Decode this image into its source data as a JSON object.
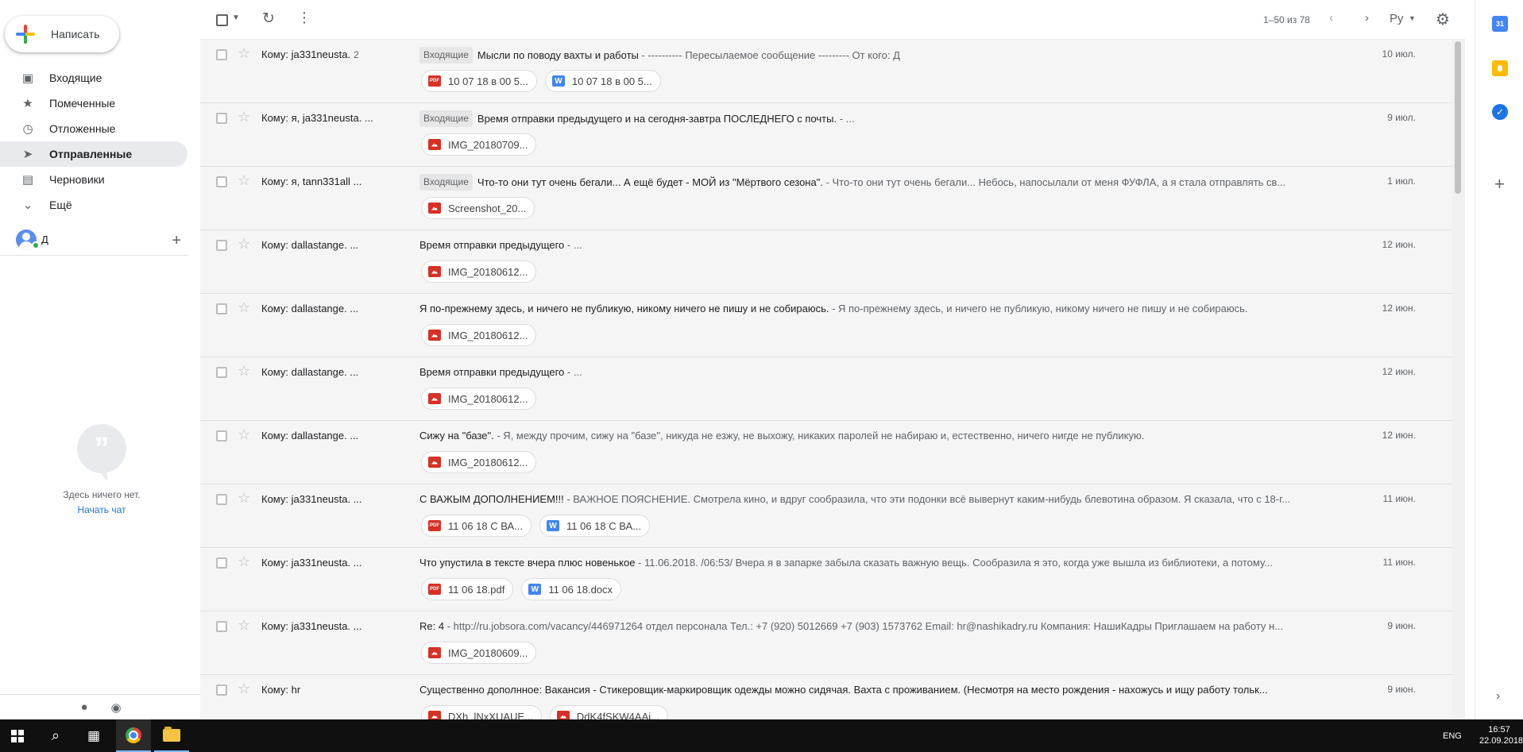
{
  "sidebar": {
    "compose_label": "Написать",
    "nav": [
      {
        "label": "Входящие",
        "icon": "inbox-icon",
        "active": false
      },
      {
        "label": "Помеченные",
        "icon": "star-icon",
        "active": false
      },
      {
        "label": "Отложенные",
        "icon": "clock-icon",
        "active": false
      },
      {
        "label": "Отправленные",
        "icon": "send-icon",
        "active": true
      },
      {
        "label": "Черновики",
        "icon": "draft-icon",
        "active": false
      },
      {
        "label": "Ещё",
        "icon": "chevron-down-icon",
        "active": false
      }
    ],
    "user": {
      "name": "Д"
    },
    "hangouts": {
      "empty_text": "Здесь ничего нет.",
      "start_chat": "Начать чат"
    }
  },
  "toolbar": {
    "pagination": "1–50 из 78",
    "language": "Ру"
  },
  "emails": [
    {
      "sender": "Кому: ja331neusta.",
      "count": "2",
      "badge": "Входящие",
      "subject": "Мысли по поводу вахты и работы",
      "snippet": " - ---------- Пересылаемое сообщение --------- От кого: Д",
      "date": "10 июл.",
      "attachments": [
        {
          "name": "10 07 18 в 00 5...",
          "type": "pdf"
        },
        {
          "name": "10 07 18 в 00 5...",
          "type": "doc"
        }
      ]
    },
    {
      "sender": "Кому: я, ja331neusta. ...",
      "count": "",
      "badge": "Входящие",
      "subject": "Время отправки предыдущего и на сегодня-завтра ПОСЛЕДНЕГО с почты.",
      "snippet": " - ...",
      "date": "9 июл.",
      "attachments": [
        {
          "name": "IMG_20180709...",
          "type": "img"
        }
      ]
    },
    {
      "sender": "Кому: я, tann331all ...",
      "count": "",
      "badge": "Входящие",
      "subject": "Что-то они тут очень бегали... А ещё будет - МОЙ из \"Мёртвого сезона\".",
      "snippet": " - Что-то они тут очень бегали... Небось, напосылали от меня ФУФЛА, а я стала отправлять св...",
      "date": "1 июл.",
      "attachments": [
        {
          "name": "Screenshot_20...",
          "type": "img"
        }
      ]
    },
    {
      "sender": "Кому: dallastange. ...",
      "count": "",
      "badge": "",
      "subject": "Время отправки предыдущего",
      "snippet": " - ...",
      "date": "12 июн.",
      "attachments": [
        {
          "name": "IMG_20180612...",
          "type": "img"
        }
      ]
    },
    {
      "sender": "Кому: dallastange. ...",
      "count": "",
      "badge": "",
      "subject": "Я по-прежнему здесь, и ничего не публикую, никому ничего не пишу и не собираюсь.",
      "snippet": " - Я по-прежнему здесь, и ничего не публикую, никому ничего не пишу и не собираюсь.",
      "date": "12 июн.",
      "attachments": [
        {
          "name": "IMG_20180612...",
          "type": "img"
        }
      ]
    },
    {
      "sender": "Кому: dallastange. ...",
      "count": "",
      "badge": "",
      "subject": "Время отправки предыдущего",
      "snippet": " - ...",
      "date": "12 июн.",
      "attachments": [
        {
          "name": "IMG_20180612...",
          "type": "img"
        }
      ]
    },
    {
      "sender": "Кому: dallastange. ...",
      "count": "",
      "badge": "",
      "subject": "Сижу на \"базе\".",
      "snippet": " - Я, между прочим, сижу на \"базе\", никуда не езжу, не выхожу, никаких паролей не набираю и, естественно, ничего нигде не публикую.",
      "date": "12 июн.",
      "attachments": [
        {
          "name": "IMG_20180612...",
          "type": "img"
        }
      ]
    },
    {
      "sender": "Кому: ja331neusta. ...",
      "count": "",
      "badge": "",
      "subject": "С ВАЖЫМ ДОПОЛНЕНИЕМ!!!",
      "snippet": " - ВАЖНОЕ ПОЯСНЕНИЕ. Смотрела кино, и вдруг сообразила, что эти подонки всё вывернут каким-нибудь блевотина образом. Я сказала, что с 18-г...",
      "date": "11 июн.",
      "attachments": [
        {
          "name": "11 06 18 С ВА...",
          "type": "pdf"
        },
        {
          "name": "11 06 18 С ВА...",
          "type": "doc"
        }
      ]
    },
    {
      "sender": "Кому: ja331neusta. ...",
      "count": "",
      "badge": "",
      "subject": "Что упустила в тексте вчера плюс новенькое",
      "snippet": " - 11.06.2018. /06:53/ Вчера я в запарке забыла сказать важную вещь. Сообразила я это, когда уже вышла из библиотеки, а потому...",
      "date": "11 июн.",
      "attachments": [
        {
          "name": "11 06 18.pdf",
          "type": "pdf"
        },
        {
          "name": "11 06 18.docx",
          "type": "doc"
        }
      ]
    },
    {
      "sender": "Кому: ja331neusta. ...",
      "count": "",
      "badge": "",
      "subject": "Re: 4",
      "snippet": " - http://ru.jobsora.com/vacancy/446971264 отдел персонала Тел.: +7 (920) 5012669 +7 (903) 1573762 Email: hr@nashikadry.ru Компания: НашиКадры Приглашаем на работу н...",
      "date": "9 июн.",
      "attachments": [
        {
          "name": "IMG_20180609...",
          "type": "img"
        }
      ]
    },
    {
      "sender": "Кому: hr",
      "count": "",
      "badge": "",
      "subject": "Существенно дополнное: Вакансия - Стикеровщик-маркировщик одежды можно сидячая. Вахта с проживанием. (Несмотря на место рождения - нахожусь и ищу работу тольк...",
      "snippet": "",
      "date": "9 июн.",
      "attachments": [
        {
          "name": "DXh_lNxXUAUE...",
          "type": "img"
        },
        {
          "name": "DdK4fSKW4AAi...",
          "type": "img"
        }
      ]
    }
  ],
  "taskbar": {
    "language": "ENG",
    "time": "16:57",
    "date": "22.09.2018"
  },
  "right_panel": {
    "calendar_day": "31"
  }
}
